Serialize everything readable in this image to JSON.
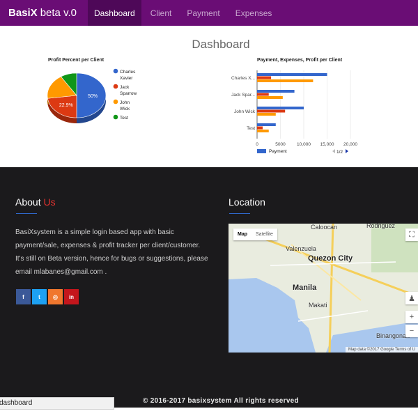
{
  "navbar": {
    "brand_bold": "BasiX",
    "brand_rest": "beta v.0",
    "items": [
      "Dashboard",
      "Client",
      "Payment",
      "Expenses"
    ],
    "active_index": 0,
    "color": "#6a0d75"
  },
  "dashboard": {
    "title": "Dashboard"
  },
  "chart_data": [
    {
      "type": "pie",
      "title": "Profit Percent per Client",
      "slices": [
        {
          "label": "Charles Xavier",
          "value": 50.0,
          "color": "#3366cc",
          "display": "50%"
        },
        {
          "label": "Jack Sparrow",
          "value": 22.9,
          "color": "#dc3912",
          "display": "22.9%"
        },
        {
          "label": "John Wick",
          "value": 18.1,
          "color": "#ff9900",
          "display": ""
        },
        {
          "label": "Test",
          "value": 9.0,
          "color": "#109618",
          "display": ""
        }
      ],
      "legend": [
        {
          "lines": [
            "Charles",
            "Xavier"
          ],
          "color": "#3366cc"
        },
        {
          "lines": [
            "Jack",
            "Sparrow"
          ],
          "color": "#dc3912"
        },
        {
          "lines": [
            "John",
            "Wick"
          ],
          "color": "#ff9900"
        },
        {
          "lines": [
            "Test"
          ],
          "color": "#109618"
        }
      ],
      "legend_position": "right"
    },
    {
      "type": "bar",
      "orientation": "horizontal",
      "title": "Payment, Expenses, Profit per Client",
      "categories": [
        "Charles X...",
        "Jack Spar...",
        "John Wick",
        "Test"
      ],
      "series": [
        {
          "name": "Payment",
          "color": "#3366cc",
          "values": [
            15000,
            8000,
            10000,
            4000
          ]
        },
        {
          "color": "#dc3912",
          "values": [
            3000,
            2500,
            6000,
            1200
          ]
        },
        {
          "color": "#ff9900",
          "values": [
            12000,
            5500,
            4000,
            2500
          ]
        }
      ],
      "xlim": [
        0,
        20000
      ],
      "xticks": [
        "0",
        "5000",
        "10,000",
        "15,000",
        "20,000"
      ],
      "legend_position": "bottom",
      "legend_page": "1/2"
    }
  ],
  "about": {
    "title_main": "About",
    "title_accent": "Us",
    "lines": [
      "BasiXsystem is a simple login based app with basic",
      "payment/sale, expenses & profit tracker per client/customer.",
      "It's still on Beta version, hence for bugs or suggestions, please",
      "email mlabanes@gmail.com ."
    ]
  },
  "social": [
    {
      "icon": "facebook-icon",
      "glyph": "f",
      "color": "#3b5998"
    },
    {
      "icon": "twitter-icon",
      "glyph": "t",
      "color": "#1da1f2"
    },
    {
      "icon": "instagram-icon",
      "glyph": "◎",
      "color": "#f0772e"
    },
    {
      "icon": "linkedin-icon",
      "glyph": "in",
      "color": "#c4161c"
    }
  ],
  "location": {
    "title": "Location",
    "map": {
      "tab_map": "Map",
      "tab_satellite": "Satellite",
      "labels": {
        "caloocan": "Caloocan",
        "rodriguez": "Rodriguez",
        "valenzuela": "Valenzuela",
        "quezon": "Quezon City",
        "manila": "Manila",
        "makati": "Makati",
        "binangonan": "Binangonan"
      },
      "credit": "Map data ©2017 Google   Terms of U",
      "zoom_in": "+",
      "zoom_out": "−"
    }
  },
  "footer": {
    "text": "© 2016-2017 basixsystem All rights reserved"
  },
  "status_bar": {
    "text": "dashboard"
  }
}
